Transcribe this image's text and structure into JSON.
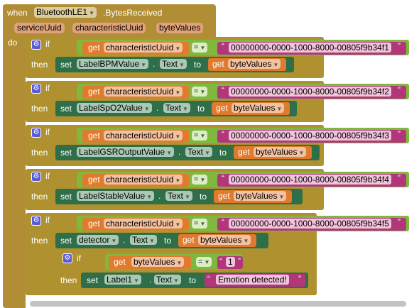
{
  "event": {
    "when": "when",
    "component": "BluetoothLE1",
    "event_name": ".BytesReceived",
    "params": [
      "serviceUuid",
      "characteristicUuid",
      "byteValues"
    ],
    "do": "do"
  },
  "kw": {
    "if": "if",
    "then": "then",
    "get": "get",
    "set": "set",
    "to": "to",
    "eq": "=",
    "dot": ".",
    "text_prop": "Text"
  },
  "branches": [
    {
      "get_var": "characteristicUuid",
      "uuid": "00000000-0000-1000-8000-00805f9b34f1",
      "target": "LabelBPMValue",
      "prop": "Text",
      "value_var": "byteValues"
    },
    {
      "get_var": "characteristicUuid",
      "uuid": "00000000-0000-1000-8000-00805f9b34f2",
      "target": "LabelSpO2Value",
      "prop": "Text",
      "value_var": "byteValues"
    },
    {
      "get_var": "characteristicUuid",
      "uuid": "00000000-0000-1000-8000-00805f9b34f3",
      "target": "LabelGSROutputValue",
      "prop": "Text",
      "value_var": "byteValues"
    },
    {
      "get_var": "characteristicUuid",
      "uuid": "00000000-0000-1000-8000-00805f9b34f4",
      "target": "LabelStableValue",
      "prop": "Text",
      "value_var": "byteValues"
    },
    {
      "get_var": "characteristicUuid",
      "uuid": "00000000-0000-1000-8000-00805f9b34f5",
      "target": "detector",
      "prop": "Text",
      "value_var": "byteValues"
    }
  ],
  "nested": {
    "get_var": "byteValues",
    "compare_value": "1",
    "target": "Label1",
    "prop": "Text",
    "message": "Emotion detected!"
  },
  "icons": {
    "gear": "gear-icon",
    "dropdown": "dropdown-arrow-icon"
  }
}
